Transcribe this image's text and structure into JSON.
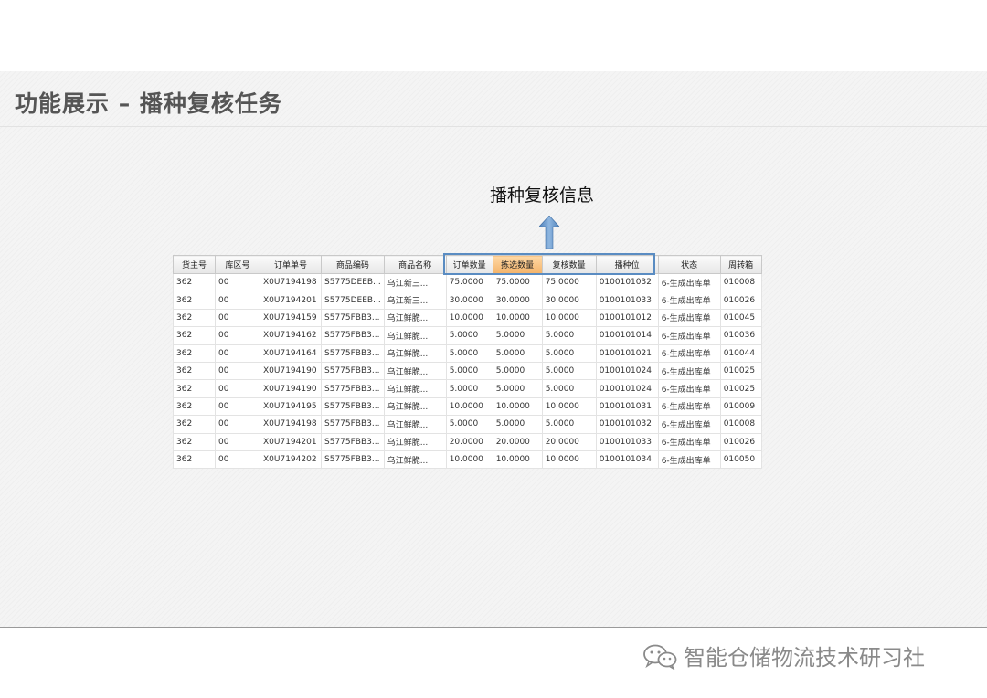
{
  "slide": {
    "title": "功能展示 – 播种复核任务",
    "callout": "播种复核信息"
  },
  "table": {
    "headers": [
      "货主号",
      "库区号",
      "订单单号",
      "商品编码",
      "商品名称",
      "订单数量",
      "拣选数量",
      "复核数量",
      "播种位",
      "状态",
      "周转箱"
    ],
    "highlighted_header": "拣选数量",
    "rows": [
      [
        "362",
        "00",
        "X0U7194198",
        "S5775DEEB...",
        "乌江新三...",
        "75.0000",
        "75.0000",
        "75.0000",
        "0100101032",
        "6-生成出库单",
        "010008"
      ],
      [
        "362",
        "00",
        "X0U7194201",
        "S5775DEEB...",
        "乌江新三...",
        "30.0000",
        "30.0000",
        "30.0000",
        "0100101033",
        "6-生成出库单",
        "010026"
      ],
      [
        "362",
        "00",
        "X0U7194159",
        "S5775FBB3...",
        "乌江鲜脆...",
        "10.0000",
        "10.0000",
        "10.0000",
        "0100101012",
        "6-生成出库单",
        "010045"
      ],
      [
        "362",
        "00",
        "X0U7194162",
        "S5775FBB3...",
        "乌江鲜脆...",
        "5.0000",
        "5.0000",
        "5.0000",
        "0100101014",
        "6-生成出库单",
        "010036"
      ],
      [
        "362",
        "00",
        "X0U7194164",
        "S5775FBB3...",
        "乌江鲜脆...",
        "5.0000",
        "5.0000",
        "5.0000",
        "0100101021",
        "6-生成出库单",
        "010044"
      ],
      [
        "362",
        "00",
        "X0U7194190",
        "S5775FBB3...",
        "乌江鲜脆...",
        "5.0000",
        "5.0000",
        "5.0000",
        "0100101024",
        "6-生成出库单",
        "010025"
      ],
      [
        "362",
        "00",
        "X0U7194190",
        "S5775FBB3...",
        "乌江鲜脆...",
        "5.0000",
        "5.0000",
        "5.0000",
        "0100101024",
        "6-生成出库单",
        "010025"
      ],
      [
        "362",
        "00",
        "X0U7194195",
        "S5775FBB3...",
        "乌江鲜脆...",
        "10.0000",
        "10.0000",
        "10.0000",
        "0100101031",
        "6-生成出库单",
        "010009"
      ],
      [
        "362",
        "00",
        "X0U7194198",
        "S5775FBB3...",
        "乌江鲜脆...",
        "5.0000",
        "5.0000",
        "5.0000",
        "0100101032",
        "6-生成出库单",
        "010008"
      ],
      [
        "362",
        "00",
        "X0U7194201",
        "S5775FBB3...",
        "乌江鲜脆...",
        "20.0000",
        "20.0000",
        "20.0000",
        "0100101033",
        "6-生成出库单",
        "010026"
      ],
      [
        "362",
        "00",
        "X0U7194202",
        "S5775FBB3...",
        "乌江鲜脆...",
        "10.0000",
        "10.0000",
        "10.0000",
        "0100101034",
        "6-生成出库单",
        "010050"
      ]
    ]
  },
  "watermark": {
    "text": "智能仓储物流技术研习社",
    "icon": "wechat-icon"
  },
  "colors": {
    "highlight": "#f3b36a",
    "group_border": "#5a8cc2",
    "arrow": "#5b8fc6"
  }
}
